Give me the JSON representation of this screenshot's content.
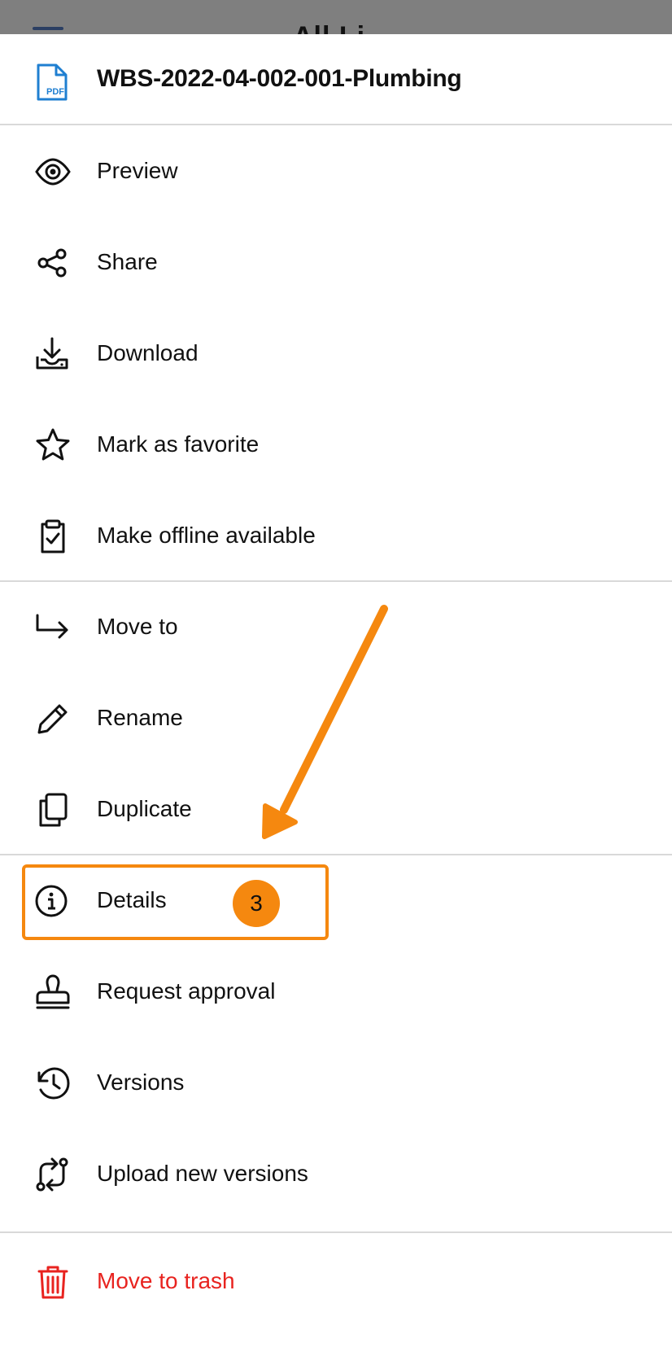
{
  "backdrop": {
    "peek_title": "All Li"
  },
  "sheet": {
    "file_name": "WBS-2022-04-002-001-Plumbing",
    "file_type_label": "PDF",
    "groups": [
      [
        {
          "label": "Preview",
          "icon": "eye-icon"
        },
        {
          "label": "Share",
          "icon": "share-icon"
        },
        {
          "label": "Download",
          "icon": "download-icon"
        },
        {
          "label": "Mark as favorite",
          "icon": "star-icon"
        },
        {
          "label": "Make offline available",
          "icon": "clipboard-check-icon"
        }
      ],
      [
        {
          "label": "Move to",
          "icon": "move-arrow-icon"
        },
        {
          "label": "Rename",
          "icon": "pencil-icon"
        },
        {
          "label": "Duplicate",
          "icon": "duplicate-icon"
        }
      ],
      [
        {
          "label": "Details",
          "icon": "info-icon"
        },
        {
          "label": "Request approval",
          "icon": "stamp-icon"
        },
        {
          "label": "Versions",
          "icon": "history-icon"
        },
        {
          "label": "Upload new versions",
          "icon": "sync-versions-icon"
        }
      ],
      [
        {
          "label": "Move to trash",
          "icon": "trash-icon"
        }
      ]
    ]
  },
  "annotation": {
    "step_number": "3"
  },
  "colors": {
    "accent_orange": "#f5880f",
    "danger_red": "#e8231f",
    "pdf_blue": "#1f7fd1"
  }
}
